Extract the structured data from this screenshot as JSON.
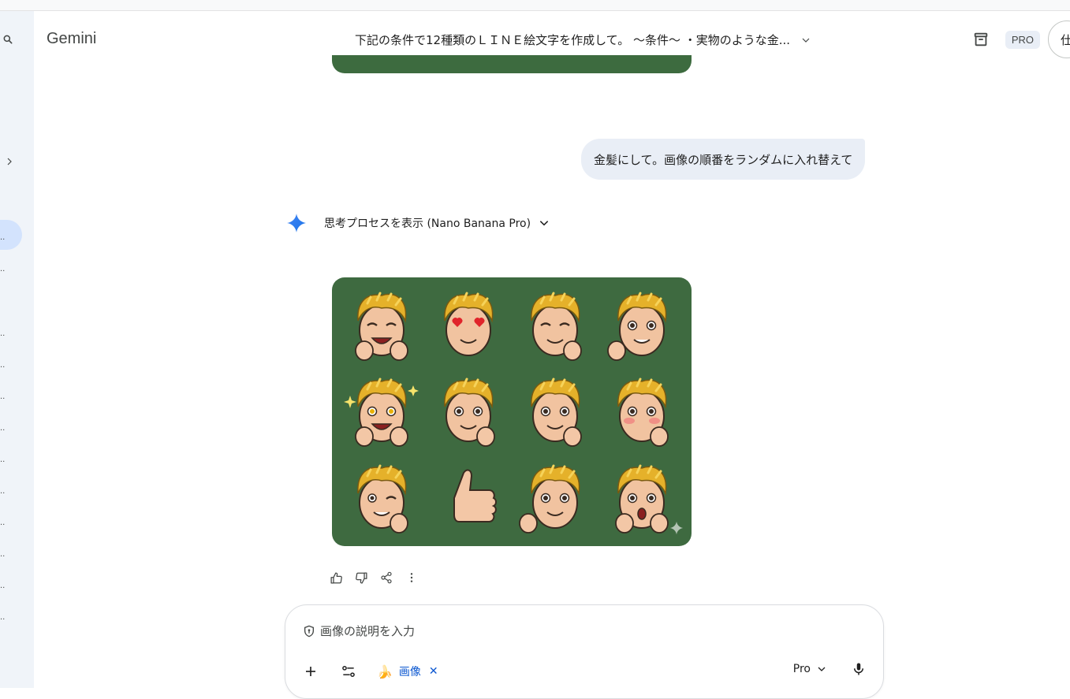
{
  "app": {
    "brand": "Gemini"
  },
  "header": {
    "conversation_title": "下記の条件で12種類のＬＩＮＥ絵文字を作成して。 〜条件〜 ・実物のような金...",
    "plan_badge": "PRO",
    "account_char": "仕"
  },
  "sidebar": {
    "collapsed_item_marks": [
      "..",
      "..",
      "..",
      "..",
      "..",
      "..",
      "..",
      "..",
      "..",
      "..",
      "..",
      "..",
      ".."
    ]
  },
  "chat": {
    "user_message": "金髪にして。画像の順番をランダムに入れ替えて",
    "thinking_label": "思考プロセスを表示 (Nano Banana Pro)",
    "image_alt": "12 emoji stickers of a blond cartoon man on a green background",
    "stickers": [
      "laughing-hands-together",
      "heart-eyes-finger-heart",
      "praying-hands",
      "confident-thumbs-up",
      "sparkle-eyes-jazz-hands",
      "smirk-clapping",
      "hand-covering-face",
      "blushing-hand-over-mouth",
      "wink-thumbs-up",
      "big-thumbs-up",
      "fist-bump",
      "shocked-hands-on-cheeks"
    ]
  },
  "actions": [
    "thumbs-up-icon",
    "thumbs-down-icon",
    "share-icon",
    "more-vert-icon"
  ],
  "composer": {
    "placeholder": "画像の説明を入力",
    "chip_label": "画像",
    "chip_emoji": "🍌",
    "model": "Pro"
  },
  "colors": {
    "sheet_bg": "#3e6a40",
    "sidebar_bg": "#f0f4f9",
    "bubble_bg": "#e9eef6",
    "accent_blue": "#0b57d0"
  }
}
